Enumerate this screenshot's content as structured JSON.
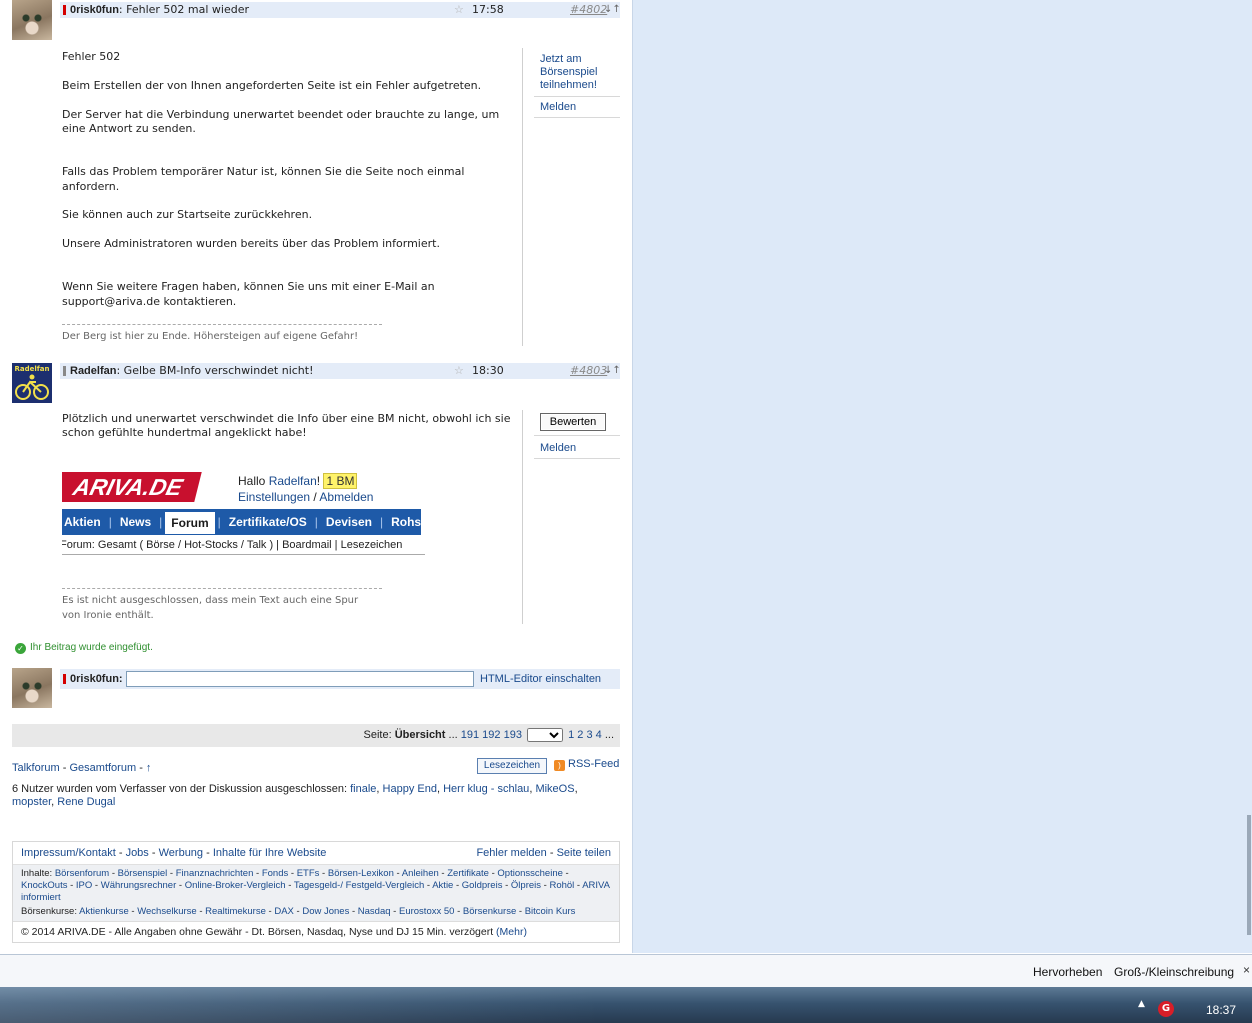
{
  "post1": {
    "author": "0risk0fun",
    "title": "Fehler 502 mal wieder",
    "star": "☆",
    "time": "17:58",
    "number": "#4802",
    "arrows": "↓↑",
    "body": [
      "Fehler 502",
      "Beim Erstellen der von Ihnen angeforderten Seite ist ein Fehler aufgetreten.",
      "Der Server hat die Verbindung unerwartet beendet oder brauchte zu lange, um eine Antwort zu senden.",
      "Falls das Problem temporärer Natur ist, können Sie die Seite noch einmal anfordern.",
      "Sie können auch zur Startseite zurückkehren.",
      "Unsere Administratoren wurden bereits über das Problem informiert.",
      "Wenn Sie weitere Fragen haben, können Sie uns mit einer E-Mail an support@ariva.de kontaktieren."
    ],
    "signature": "Der Berg ist hier zu Ende. Höhersteigen auf eigene Gefahr!",
    "side": {
      "boersenspiel": "Jetzt am Börsenspiel teilnehmen!",
      "melden": "Melden"
    }
  },
  "post2": {
    "author": "Radelfan",
    "title": "Gelbe BM-Info verschwindet nicht!",
    "star": "☆",
    "time": "18:30",
    "number": "#4803",
    "arrows": "↓↑",
    "body": "Plötzlich und unerwartet verschwindet die Info über eine BM nicht, obwohl ich sie schon gefühlte hundertmal angeklickt habe!",
    "signature": "Es ist nicht ausgeschlossen, dass mein Text auch eine Spur von Ironie enthält.",
    "side": {
      "bewerten": "Bewerten",
      "melden": "Melden"
    },
    "avatar_text": "Radelfan",
    "embed": {
      "logo": "ARIVA.DE",
      "hallo": "Hallo",
      "user": "Radelfan",
      "excl": "!",
      "bm": "1 BM",
      "einstellungen": "Einstellungen",
      "slash": "/",
      "abmelden": "Abmelden",
      "nav": [
        "Aktien",
        "News",
        "Forum",
        "Zertifikate/OS",
        "Devisen",
        "Rohst"
      ],
      "sub": "Forum: Gesamt ( Börse / Hot-Stocks / Talk ) | Boardmail | Lesezeichen"
    }
  },
  "success": "Ihr Beitrag wurde eingefügt.",
  "reply": {
    "author": "0risk0fun",
    "colon": ":",
    "input_value": "",
    "html_editor": "HTML-Editor einschalten"
  },
  "pager": {
    "label": "Seite:",
    "overview": "Übersicht",
    "ellipsis1": "...",
    "pages_before": [
      "191",
      "192",
      "193"
    ],
    "select_value": "",
    "pages_after": [
      "1",
      "2",
      "3",
      "4"
    ],
    "ellipsis2": "..."
  },
  "links": {
    "talkforum": "Talkforum",
    "gesamtforum": "Gesamtforum",
    "up": "↑",
    "dash": "-"
  },
  "lesezeichen_button": "Lesezeichen",
  "rss": "RSS-Feed",
  "excluded": {
    "prefix": "6 Nutzer wurden vom Verfasser von der Diskussion ausgeschlossen:",
    "users": [
      "finale",
      "Happy End",
      "Herr klug - schlau",
      "MikeOS",
      "mopster",
      "Rene Dugal"
    ]
  },
  "footer": {
    "left": [
      "Impressum/Kontakt",
      "Jobs",
      "Werbung",
      "Inhalte für Ihre Website"
    ],
    "right": [
      "Fehler melden",
      "Seite teilen"
    ],
    "inhalte_label": "Inhalte:",
    "inhalte": [
      "Börsenforum",
      "Börsenspiel",
      "Finanznachrichten",
      "Fonds",
      "ETFs",
      "Börsen-Lexikon",
      "Anleihen",
      "Zertifikate",
      "Optionsscheine",
      "KnockOuts",
      "IPO",
      "Währungsrechner",
      "Online-Broker-Vergleich",
      "Tagesgeld-/ Festgeld-Vergleich",
      "Aktie",
      "Goldpreis",
      "Ölpreis",
      "Rohöl",
      "ARIVA informiert"
    ],
    "kurse_label": "Börsenkurse:",
    "kurse": [
      "Aktienkurse",
      "Wechselkurse",
      "Realtimekurse",
      "DAX",
      "Dow Jones",
      "Nasdaq",
      "Eurostoxx 50",
      "Börsenkurse",
      "Bitcoin Kurs"
    ],
    "copyright": "© 2014 ARIVA.DE - Alle Angaben ohne Gewähr - Dt. Börsen, Nasdaq, Nyse und DJ 15 Min. verzögert",
    "mehr": "(Mehr)"
  },
  "findbar": {
    "hervorheben": "Hervorheben",
    "gross_klein": "Groß-/Kleinschreibung",
    "close": "×"
  },
  "taskbar": {
    "clock": "18:37",
    "tray_arrow": "▲",
    "g": "G"
  },
  "colors": {
    "accent": "#1a4a8c",
    "header_bg": "#e4ecf8",
    "red_mark": "#d40000",
    "gray_mark": "#888888",
    "success": "#2f8f2f"
  }
}
